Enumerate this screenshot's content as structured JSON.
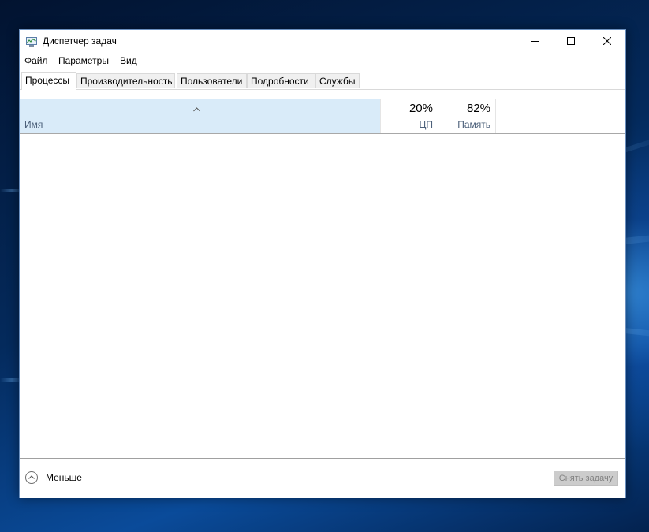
{
  "window": {
    "title": "Диспетчер задач",
    "controls": {
      "minimize_icon": "minimize-icon",
      "maximize_icon": "maximize-icon",
      "close_icon": "close-icon"
    }
  },
  "menu": {
    "items": [
      {
        "label": "Файл"
      },
      {
        "label": "Параметры"
      },
      {
        "label": "Вид"
      }
    ]
  },
  "tabs": [
    {
      "label": "Процессы",
      "active": true
    },
    {
      "label": "Производительность",
      "active": false
    },
    {
      "label": "Пользователи",
      "active": false
    },
    {
      "label": "Подробности",
      "active": false
    },
    {
      "label": "Службы",
      "active": false
    }
  ],
  "table": {
    "name_header": "Имя",
    "sort_icon": "chevron-up-icon",
    "cpu": {
      "percent": "20%",
      "label": "ЦП"
    },
    "memory": {
      "percent": "82%",
      "label": "Память"
    },
    "rows": []
  },
  "footer": {
    "less_label": "Меньше",
    "less_icon": "chevron-up-circle-icon",
    "end_task_label": "Снять задачу",
    "end_task_enabled": false
  },
  "colors": {
    "header_highlight": "#d9ebf9",
    "desktop_blue": "#0a4b9a",
    "disabled_button": "#cccccc"
  }
}
